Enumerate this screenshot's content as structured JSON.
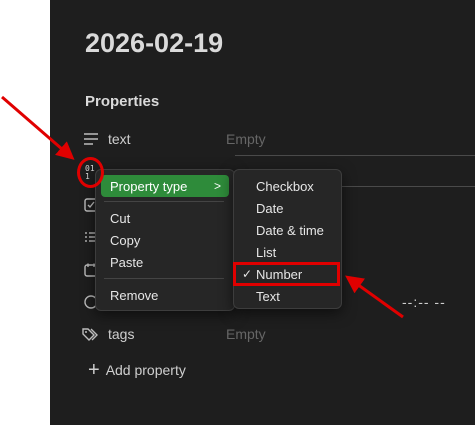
{
  "page": {
    "title": "2026-02-19"
  },
  "properties": {
    "heading": "Properties",
    "rows": [
      {
        "name": "text",
        "value": "Empty",
        "icon": "text-lines-icon"
      },
      {
        "name": "",
        "value": "",
        "icon": "number-icon"
      },
      {
        "name": "",
        "value": "",
        "icon": "checkbox-icon"
      },
      {
        "name": "",
        "value": "",
        "icon": "list-icon"
      },
      {
        "name": "",
        "value": "",
        "icon": "calendar-icon"
      },
      {
        "name": "",
        "value": "--:-- --",
        "icon": "clock-icon"
      },
      {
        "name": "tags",
        "value": "Empty",
        "icon": "tag-icon"
      }
    ],
    "add_label": "Add property"
  },
  "context_menu": {
    "property_type": "Property type",
    "cut": "Cut",
    "copy": "Copy",
    "paste": "Paste",
    "remove": "Remove"
  },
  "type_submenu": {
    "items": [
      "Checkbox",
      "Date",
      "Date & time",
      "List",
      "Number",
      "Text"
    ],
    "selected": "Number"
  },
  "colors": {
    "background": "#1e1e1e",
    "menu_bg": "#262626",
    "accent_green": "#2e8b3a",
    "annotation_red": "#e00000"
  }
}
